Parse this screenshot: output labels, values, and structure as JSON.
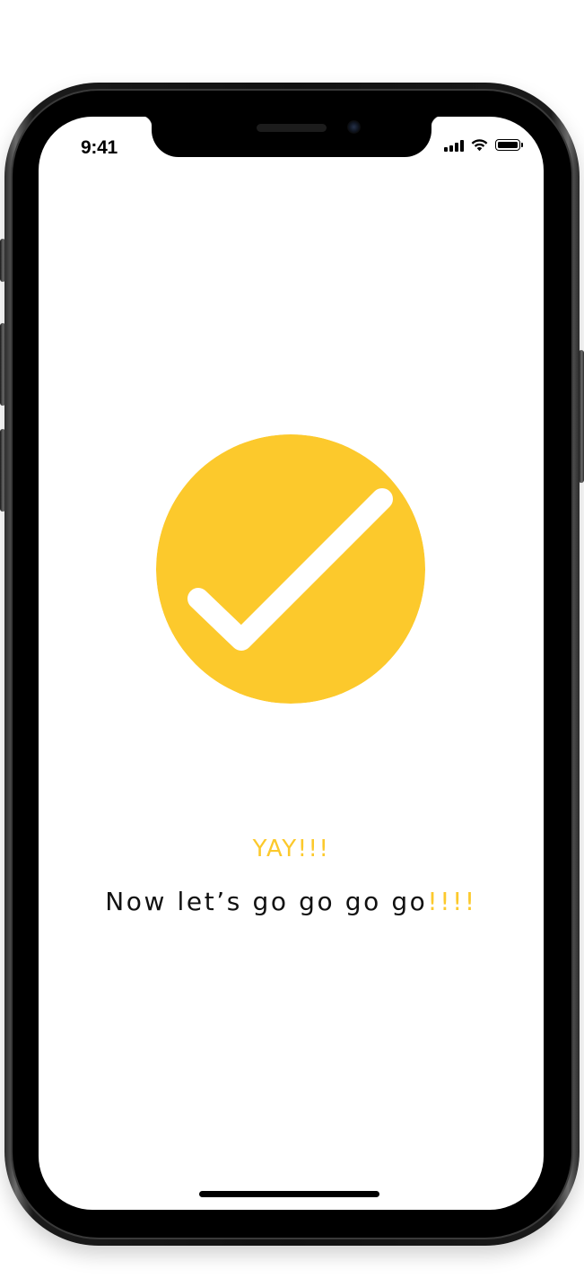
{
  "status_bar": {
    "time": "9:41",
    "icons": [
      "signal-icon",
      "wifi-icon",
      "battery-icon"
    ]
  },
  "content": {
    "icon": "checkmark-circle-icon",
    "title": "YAY!!!",
    "message_main": "Now let’s go go go go",
    "message_suffix": "!!!!"
  },
  "colors": {
    "accent": "#FCC92C",
    "text": "#111111",
    "background": "#FFFFFF",
    "device_frame": "#111111"
  }
}
